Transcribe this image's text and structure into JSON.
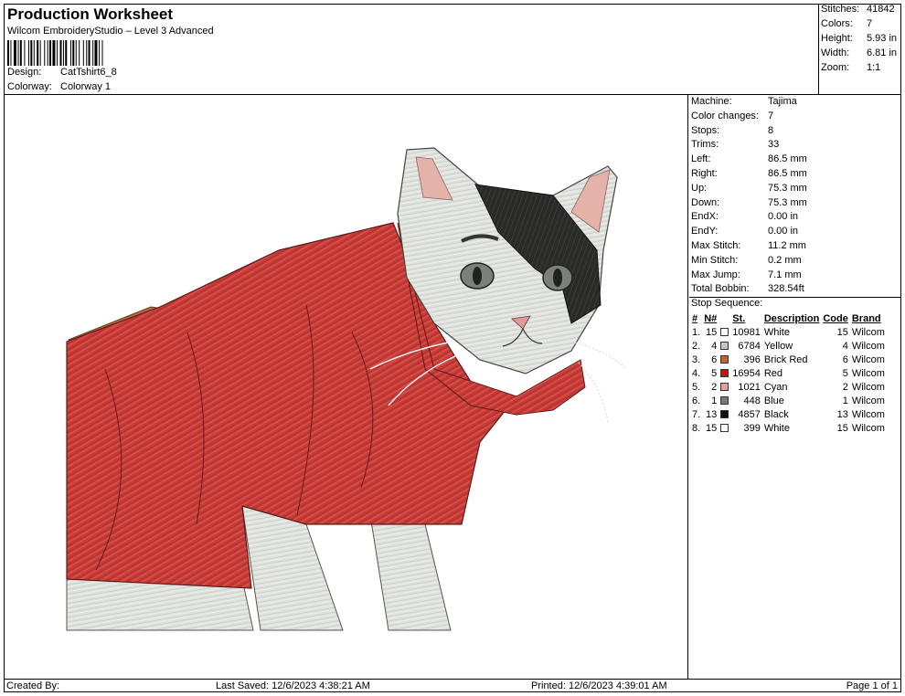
{
  "header": {
    "title": "Production Worksheet",
    "subtitle": "Wilcom EmbroideryStudio – Level 3 Advanced",
    "design_label": "Design:",
    "design_value": "CatTshirt6_8",
    "colorway_label": "Colorway:",
    "colorway_value": "Colorway 1"
  },
  "stats": [
    {
      "label": "Stitches:",
      "value": "41842"
    },
    {
      "label": "Colors:",
      "value": "7"
    },
    {
      "label": "Height:",
      "value": "5.93 in"
    },
    {
      "label": "Width:",
      "value": "6.81 in"
    },
    {
      "label": "Zoom:",
      "value": "1:1"
    }
  ],
  "machine_info": [
    {
      "label": "Machine:",
      "value": "Tajima"
    },
    {
      "label": "Color changes:",
      "value": "7"
    },
    {
      "label": "Stops:",
      "value": "8"
    },
    {
      "label": "Trims:",
      "value": "33"
    },
    {
      "label": "Left:",
      "value": "86.5 mm"
    },
    {
      "label": "Right:",
      "value": "86.5 mm"
    },
    {
      "label": "Up:",
      "value": "75.3 mm"
    },
    {
      "label": "Down:",
      "value": "75.3 mm"
    },
    {
      "label": "EndX:",
      "value": "0.00 in"
    },
    {
      "label": "EndY:",
      "value": "0.00 in"
    },
    {
      "label": "Max Stitch:",
      "value": "11.2 mm"
    },
    {
      "label": "Min Stitch:",
      "value": "0.2 mm"
    },
    {
      "label": "Max Jump:",
      "value": "7.1 mm"
    },
    {
      "label": "Total Bobbin:",
      "value": "328.54ft"
    }
  ],
  "stop_sequence": {
    "title": "Stop Sequence:",
    "headers": {
      "num": "#",
      "n": "N#",
      "st": "St.",
      "desc": "Description",
      "code": "Code",
      "brand": "Brand"
    },
    "rows": [
      {
        "num": "1.",
        "n": "15",
        "color": "#ffffff",
        "st": "10981",
        "desc": "White",
        "code": "15",
        "brand": "Wilcom"
      },
      {
        "num": "2.",
        "n": "4",
        "color": "#c4c4c4",
        "st": "6784",
        "desc": "Yellow",
        "code": "4",
        "brand": "Wilcom"
      },
      {
        "num": "3.",
        "n": "6",
        "color": "#c0643a",
        "st": "396",
        "desc": "Brick Red",
        "code": "6",
        "brand": "Wilcom"
      },
      {
        "num": "4.",
        "n": "5",
        "color": "#c01818",
        "st": "16954",
        "desc": "Red",
        "code": "5",
        "brand": "Wilcom"
      },
      {
        "num": "5.",
        "n": "2",
        "color": "#e2a0a0",
        "st": "1021",
        "desc": "Cyan",
        "code": "2",
        "brand": "Wilcom"
      },
      {
        "num": "6.",
        "n": "1",
        "color": "#7a7a7a",
        "st": "448",
        "desc": "Blue",
        "code": "1",
        "brand": "Wilcom"
      },
      {
        "num": "7.",
        "n": "13",
        "color": "#111111",
        "st": "4857",
        "desc": "Black",
        "code": "13",
        "brand": "Wilcom"
      },
      {
        "num": "8.",
        "n": "15",
        "color": "#ffffff",
        "st": "399",
        "desc": "White",
        "code": "15",
        "brand": "Wilcom"
      }
    ]
  },
  "footer": {
    "created_by": "Created By:",
    "last_saved": "Last Saved: 12/6/2023 4:38:21 AM",
    "printed": "Printed: 12/6/2023 4:39:01 AM",
    "page": "Page 1 of 1"
  }
}
